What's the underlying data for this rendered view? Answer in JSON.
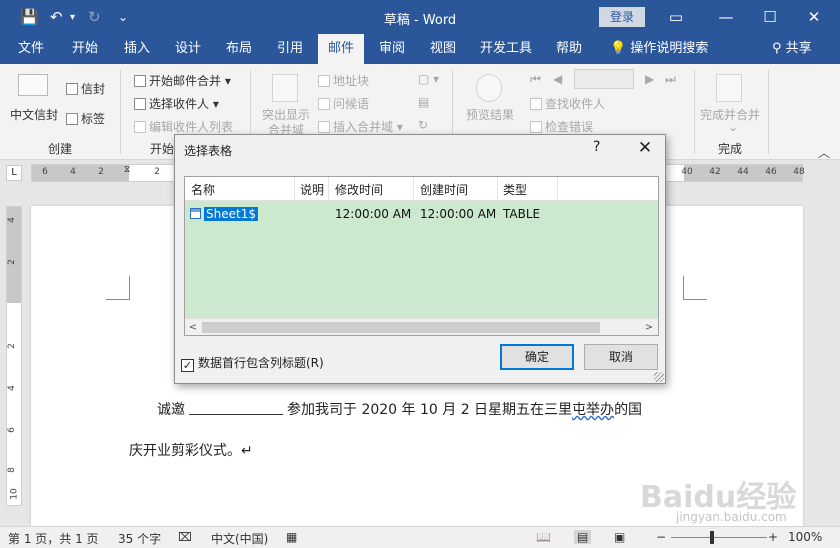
{
  "titlebar": {
    "title": "草稿  -  Word",
    "login": "登录",
    "save_icon": "save-icon",
    "undo_icon": "undo-icon",
    "redo_icon": "redo-icon",
    "minimize": "—",
    "maximize": "☐",
    "close": "✕",
    "restore_icon": "ribbon-display-icon"
  },
  "tabs": [
    "文件",
    "开始",
    "插入",
    "设计",
    "布局",
    "引用",
    "邮件",
    "审阅",
    "视图",
    "开发工具",
    "帮助"
  ],
  "active_tab": "邮件",
  "tell_me": "操作说明搜索",
  "share": "共享",
  "ribbon": {
    "create": {
      "label": "创建",
      "chinese_envelope": "中文信封",
      "envelope": "信封",
      "labels": "标签"
    },
    "start_merge": {
      "label": "开始",
      "start": "开始邮件合并 ▾",
      "select_recipients": "选择收件人 ▾",
      "edit_recipients": "编辑收件人列表"
    },
    "write_insert": {
      "highlight_line1": "突出显示",
      "highlight_line2": "合并域",
      "address_block": "地址块",
      "greeting": "问候语",
      "insert_field": "插入合并域 ▾"
    },
    "preview": {
      "preview_results": "预览结果",
      "find_recipient": "查找收件人",
      "check_errors": "检查错误"
    },
    "finish": {
      "label": "完成",
      "finish_merge": "完成并合并"
    }
  },
  "ruler": {
    "left_ticks": [
      "6",
      "4",
      "2",
      "",
      "2"
    ],
    "right_ticks": [
      "40",
      "42",
      "44",
      "46",
      "48"
    ],
    "vertical_ticks": [
      "4",
      "2",
      "",
      "2",
      "4",
      "6",
      "8",
      "10"
    ]
  },
  "document": {
    "line1_prefix": "诚邀",
    "line1_suffix": "参加我司于 2020 年 10 月 2 日星期五在三里",
    "line1_squiggle": "屯举办",
    "line1_end": "的国",
    "line2": "庆开业剪彩仪式。↵"
  },
  "dialog": {
    "title": "选择表格",
    "help": "?",
    "close": "✕",
    "columns": [
      "名称",
      "说明",
      "修改时间",
      "创建时间",
      "类型"
    ],
    "rows": [
      {
        "name": "Sheet1$",
        "description": "",
        "modified": "12:00:00 AM",
        "created": "12:00:00 AM",
        "type": "TABLE"
      }
    ],
    "checkbox_label": "数据首行包含列标题(R)",
    "checkbox_checked": true,
    "ok": "确定",
    "cancel": "取消"
  },
  "status": {
    "page": "第 1 页，共 1 页",
    "words": "35 个字",
    "language": "中文(中国)",
    "zoom": "100%",
    "zoom_minus": "−",
    "zoom_plus": "+"
  },
  "watermark": {
    "text": "Baidu经验",
    "sub": "jingyan.baidu.com"
  },
  "colors": {
    "accent": "#2b579a",
    "selection_row": "#cce8cf",
    "selected_cell": "#0078d7"
  }
}
